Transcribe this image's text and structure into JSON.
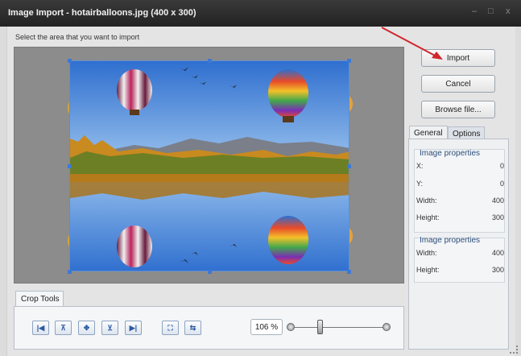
{
  "window": {
    "title": "Image Import - hotairballoons.jpg  (400 x 300)",
    "minimize_glyph": "–",
    "maximize_glyph": "□",
    "close_glyph": "x"
  },
  "prompt": "Select the area that you want to import",
  "buttons": {
    "import": "Import",
    "cancel": "Cancel",
    "browse": "Browse file..."
  },
  "tabs": {
    "general": "General",
    "options": "Options"
  },
  "image_properties": {
    "title": "Image properties",
    "rows": [
      {
        "label": "X:",
        "value": "0"
      },
      {
        "label": "Y:",
        "value": "0"
      },
      {
        "label": "Width:",
        "value": "400"
      },
      {
        "label": "Height:",
        "value": "300"
      }
    ]
  },
  "image_properties_2": {
    "title": "Image properties",
    "rows": [
      {
        "label": "Width:",
        "value": "400"
      },
      {
        "label": "Height:",
        "value": "300"
      }
    ]
  },
  "crop_tools": {
    "tab_label": "Crop Tools",
    "zoom_value": "106 %",
    "zoom_slider_fraction": 0.3,
    "tool_icons": [
      "align-left-icon",
      "align-top-icon",
      "center-icon",
      "align-bottom-icon",
      "align-right-icon",
      "fit-selection-icon",
      "reset-selection-icon"
    ]
  },
  "colors": {
    "accent_arrow": "#d0262b",
    "selection_border": "#5b8fd6",
    "titlebar": "#222222"
  }
}
